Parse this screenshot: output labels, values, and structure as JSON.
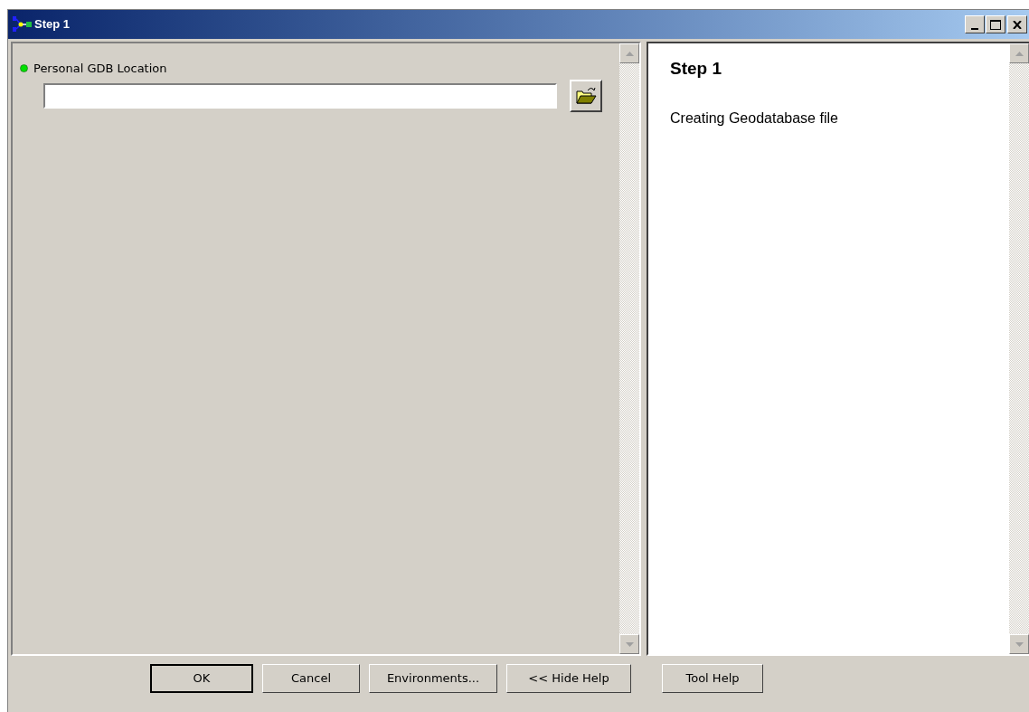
{
  "window": {
    "title": "Step 1"
  },
  "parameters": [
    {
      "label": "Personal GDB Location"
    }
  ],
  "help": {
    "title": "Step 1",
    "text": "Creating Geodatabase file"
  },
  "buttons": [
    {
      "label": "OK",
      "default": true
    },
    {
      "label": "Cancel",
      "default": false
    },
    {
      "label": "Environments...",
      "default": false
    },
    {
      "label": "<< Hide Help",
      "default": false
    }
  ],
  "help_button": {
    "label": "Tool Help"
  }
}
